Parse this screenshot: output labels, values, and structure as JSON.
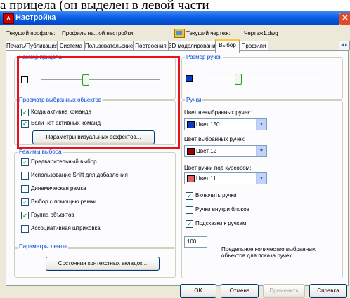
{
  "doc_text": "а прицела (он выделен в левой части",
  "window": {
    "title": "Настройка"
  },
  "profile_bar": {
    "current_profile_label": "Текущий профиль:",
    "current_profile_value": "Профиль на...ой настройки",
    "current_drawing_label": "Текущий чертеж:",
    "current_drawing_value": "Чертеж1.dwg"
  },
  "tabs": [
    "Печать/Публикация",
    "Система",
    "Пользовательские",
    "Построения",
    "3D моделирование",
    "Выбор",
    "Профили"
  ],
  "active_tab": "Выбор",
  "left": {
    "pickbox_legend": "Размер прицела",
    "preview_legend": "Просмотр выбранных объектов",
    "preview_options": [
      {
        "label": "Когда активна команда",
        "checked": true
      },
      {
        "label": "Если нет активных команд",
        "checked": true
      }
    ],
    "visual_effects_button": "Параметры визуальных эффектов...",
    "modes_legend": "Режимы выбора",
    "modes": [
      {
        "label": "Предварительный выбор",
        "checked": true
      },
      {
        "label": "Использование Shift для добавления",
        "checked": false
      },
      {
        "label": "Динамическая рамка",
        "checked": false
      },
      {
        "label": "Выбор с помощью рамки",
        "checked": true
      },
      {
        "label": "Группа объектов",
        "checked": true
      },
      {
        "label": "Ассоциативная штриховка",
        "checked": false
      }
    ],
    "ribbon_legend": "Параметры ленты",
    "ribbon_button": "Состояния контекстных вкладок..."
  },
  "right": {
    "grip_size_legend": "Размер ручек",
    "grips_legend": "Ручки",
    "unselected_label": "Цвет невыбранных ручек:",
    "unselected_value": "Цвет 150",
    "selected_label": "Цвет выбранных ручек:",
    "selected_value": "Цвет 12",
    "hover_label": "Цвет ручки под курсором:",
    "hover_value": "Цвет 11",
    "grip_options": [
      {
        "label": "Включить ручки",
        "checked": true
      },
      {
        "label": "Ручки внутри блоков",
        "checked": false
      },
      {
        "label": "Подсказки к ручкам",
        "checked": true
      }
    ],
    "limit_value": "100",
    "limit_label": "Предельное количество выбранных объектов для показа ручек"
  },
  "buttons": {
    "ok": "OK",
    "cancel": "Отмена",
    "apply": "Применить",
    "help": "Справка"
  },
  "colors": {
    "unselected": "#0a3cc8",
    "selected": "#a00000",
    "hover": "#e06060",
    "highlight": "#e8121e",
    "legend": "#0046d5"
  }
}
